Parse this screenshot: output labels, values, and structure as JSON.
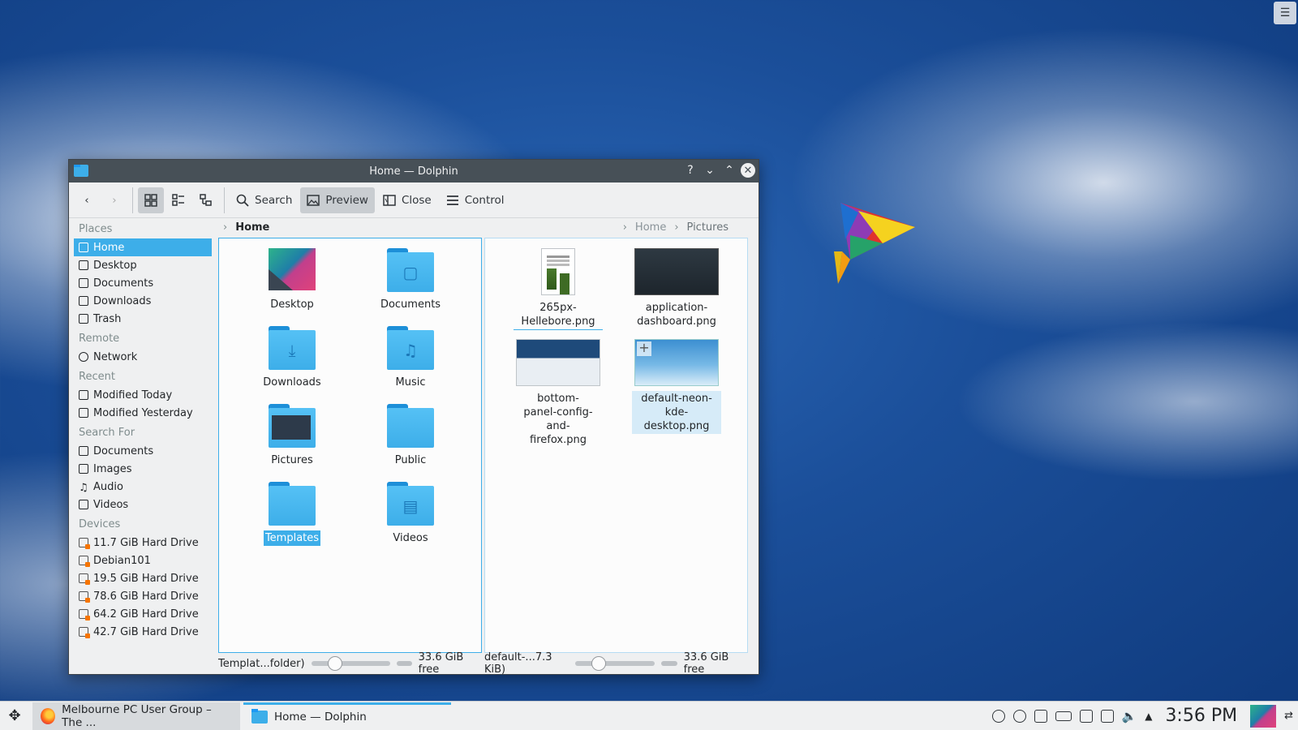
{
  "window": {
    "title": "Home — Dolphin",
    "help_btn": "?",
    "minimize_btn": "⌄",
    "maximize_btn": "⌃",
    "close_btn": "✕"
  },
  "toolbar": {
    "search_label": "Search",
    "preview_label": "Preview",
    "close_label": "Close",
    "control_label": "Control"
  },
  "places": {
    "groups": {
      "places": "Places",
      "remote": "Remote",
      "recent": "Recent",
      "search_for": "Search For",
      "devices": "Devices"
    },
    "items": [
      {
        "label": "Home",
        "icon": "home-icon"
      },
      {
        "label": "Desktop",
        "icon": "desktop-icon"
      },
      {
        "label": "Documents",
        "icon": "documents-icon"
      },
      {
        "label": "Downloads",
        "icon": "downloads-icon"
      },
      {
        "label": "Trash",
        "icon": "trash-icon"
      }
    ],
    "remote": [
      {
        "label": "Network",
        "icon": "network-icon"
      }
    ],
    "recent": [
      {
        "label": "Modified Today",
        "icon": "calendar-icon"
      },
      {
        "label": "Modified Yesterday",
        "icon": "calendar-icon"
      }
    ],
    "search": [
      {
        "label": "Documents",
        "icon": "text-icon"
      },
      {
        "label": "Images",
        "icon": "image-icon"
      },
      {
        "label": "Audio",
        "icon": "audio-icon"
      },
      {
        "label": "Videos",
        "icon": "video-icon"
      }
    ],
    "devices": [
      {
        "label": "11.7 GiB Hard Drive"
      },
      {
        "label": "Debian101"
      },
      {
        "label": "19.5 GiB Hard Drive"
      },
      {
        "label": "78.6 GiB Hard Drive"
      },
      {
        "label": "64.2 GiB Hard Drive"
      },
      {
        "label": "42.7 GiB Hard Drive"
      }
    ]
  },
  "left_pane": {
    "crumb_home": "Home",
    "folders": [
      {
        "label": "Desktop"
      },
      {
        "label": "Documents"
      },
      {
        "label": "Downloads"
      },
      {
        "label": "Music"
      },
      {
        "label": "Pictures"
      },
      {
        "label": "Public"
      },
      {
        "label": "Templates"
      },
      {
        "label": "Videos"
      }
    ],
    "status": "Templat...folder)",
    "free": "33.6 GiB free",
    "zoom_level": 0.28
  },
  "right_pane": {
    "crumb_home": "Home",
    "crumb_pictures": "Pictures",
    "files": [
      {
        "label": "265px-Hellebore.png"
      },
      {
        "label": "application-dashboard.png"
      },
      {
        "label": "bottom-panel-config-and-firefox.png"
      },
      {
        "label": "default-neon-kde-desktop.png"
      }
    ],
    "status": "default-...7.3 KiB)",
    "free": "33.6 GiB free",
    "zoom_level": 0.28
  },
  "taskbar": {
    "firefox_task": "Melbourne PC User Group – The ...",
    "dolphin_task": "Home — Dolphin",
    "clock": "3:56 PM"
  },
  "desktop": {
    "menu_icon": "☰"
  }
}
